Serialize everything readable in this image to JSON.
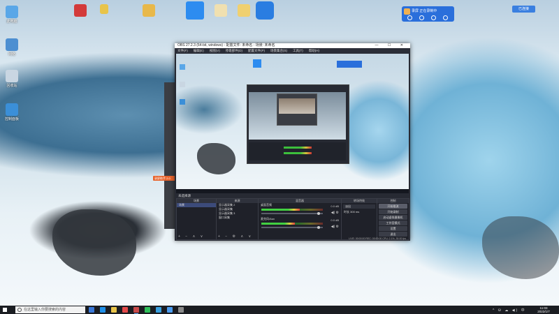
{
  "desktop": {
    "icons": [
      {
        "label": "此电脑",
        "color": "#5aa7e8"
      },
      {
        "label": "网络",
        "color": "#4d8fd1"
      },
      {
        "label": "回收站",
        "color": "#c9d6e2"
      },
      {
        "label": "控制面板",
        "color": "#3b8fd8"
      }
    ],
    "top_icons": [
      {
        "label": "",
        "color": "#d33a3a"
      },
      {
        "label": "",
        "color": "#e8c44a"
      },
      {
        "label": "",
        "color": "#e8b84a"
      },
      {
        "label": "",
        "color": "#2d8cf0"
      },
      {
        "label": "",
        "color": "#f0e0b0"
      },
      {
        "label": "",
        "color": "#f0d070"
      },
      {
        "label": "",
        "color": "#2a7de1"
      }
    ],
    "notification_title": "录屏 正在录制中",
    "tray_badge": "已连接",
    "helper_label": "录屏助手 2.0"
  },
  "obs": {
    "title": "OBS 27.2.3 (64-bit, windows) - 配置文件: 未命名 - 场景: 未命名",
    "window_controls": "—  ☐  ✕",
    "menu": [
      "文件(F)",
      "编辑(E)",
      "视图(V)",
      "停靠部件(D)",
      "配置文件(P)",
      "场景集合(S)",
      "工具(T)",
      "帮助(H)"
    ],
    "dock_title": "未选择源",
    "scenes": {
      "header": "场景",
      "items": [
        "场景"
      ]
    },
    "sources": {
      "header": "来源",
      "items": [
        "显示器采集 2",
        "显示器采集",
        "显示器采集 3",
        "窗口采集"
      ]
    },
    "mixer": {
      "header": "混音器",
      "channels": [
        {
          "name": "桌面音频",
          "db": "0.0 dB",
          "level": 0.62,
          "volume": 0.95
        },
        {
          "name": "麦克风/Aux",
          "db": "0.0 dB",
          "level": 0.55,
          "volume": 0.95
        }
      ]
    },
    "transitions": {
      "header": "转场特效",
      "type": "淡出",
      "duration_label": "时长",
      "duration": "300 ms"
    },
    "controls": {
      "header": "控制",
      "buttons": [
        "开始推流",
        "开始录制",
        "启动虚拟摄像机",
        "工作室模式",
        "设置",
        "退出"
      ]
    },
    "status": "LIVE: 00:00:00   REC: 00:00:00   CPU: 2.1%, 30.00 fps"
  },
  "taskbar": {
    "search_placeholder": "在这里输入你要搜索的内容",
    "apps": [
      "#3a78d8",
      "#1f8fe8",
      "#e8c44a",
      "#e34a4a",
      "#c84a4a",
      "#2fbf5a",
      "#39a0e0",
      "#4b9cf0",
      "#8a8a8a"
    ],
    "tray_icons": "^ ⛁ ☁ ◀) 中",
    "time": "11:03",
    "date": "2022/1/7"
  }
}
